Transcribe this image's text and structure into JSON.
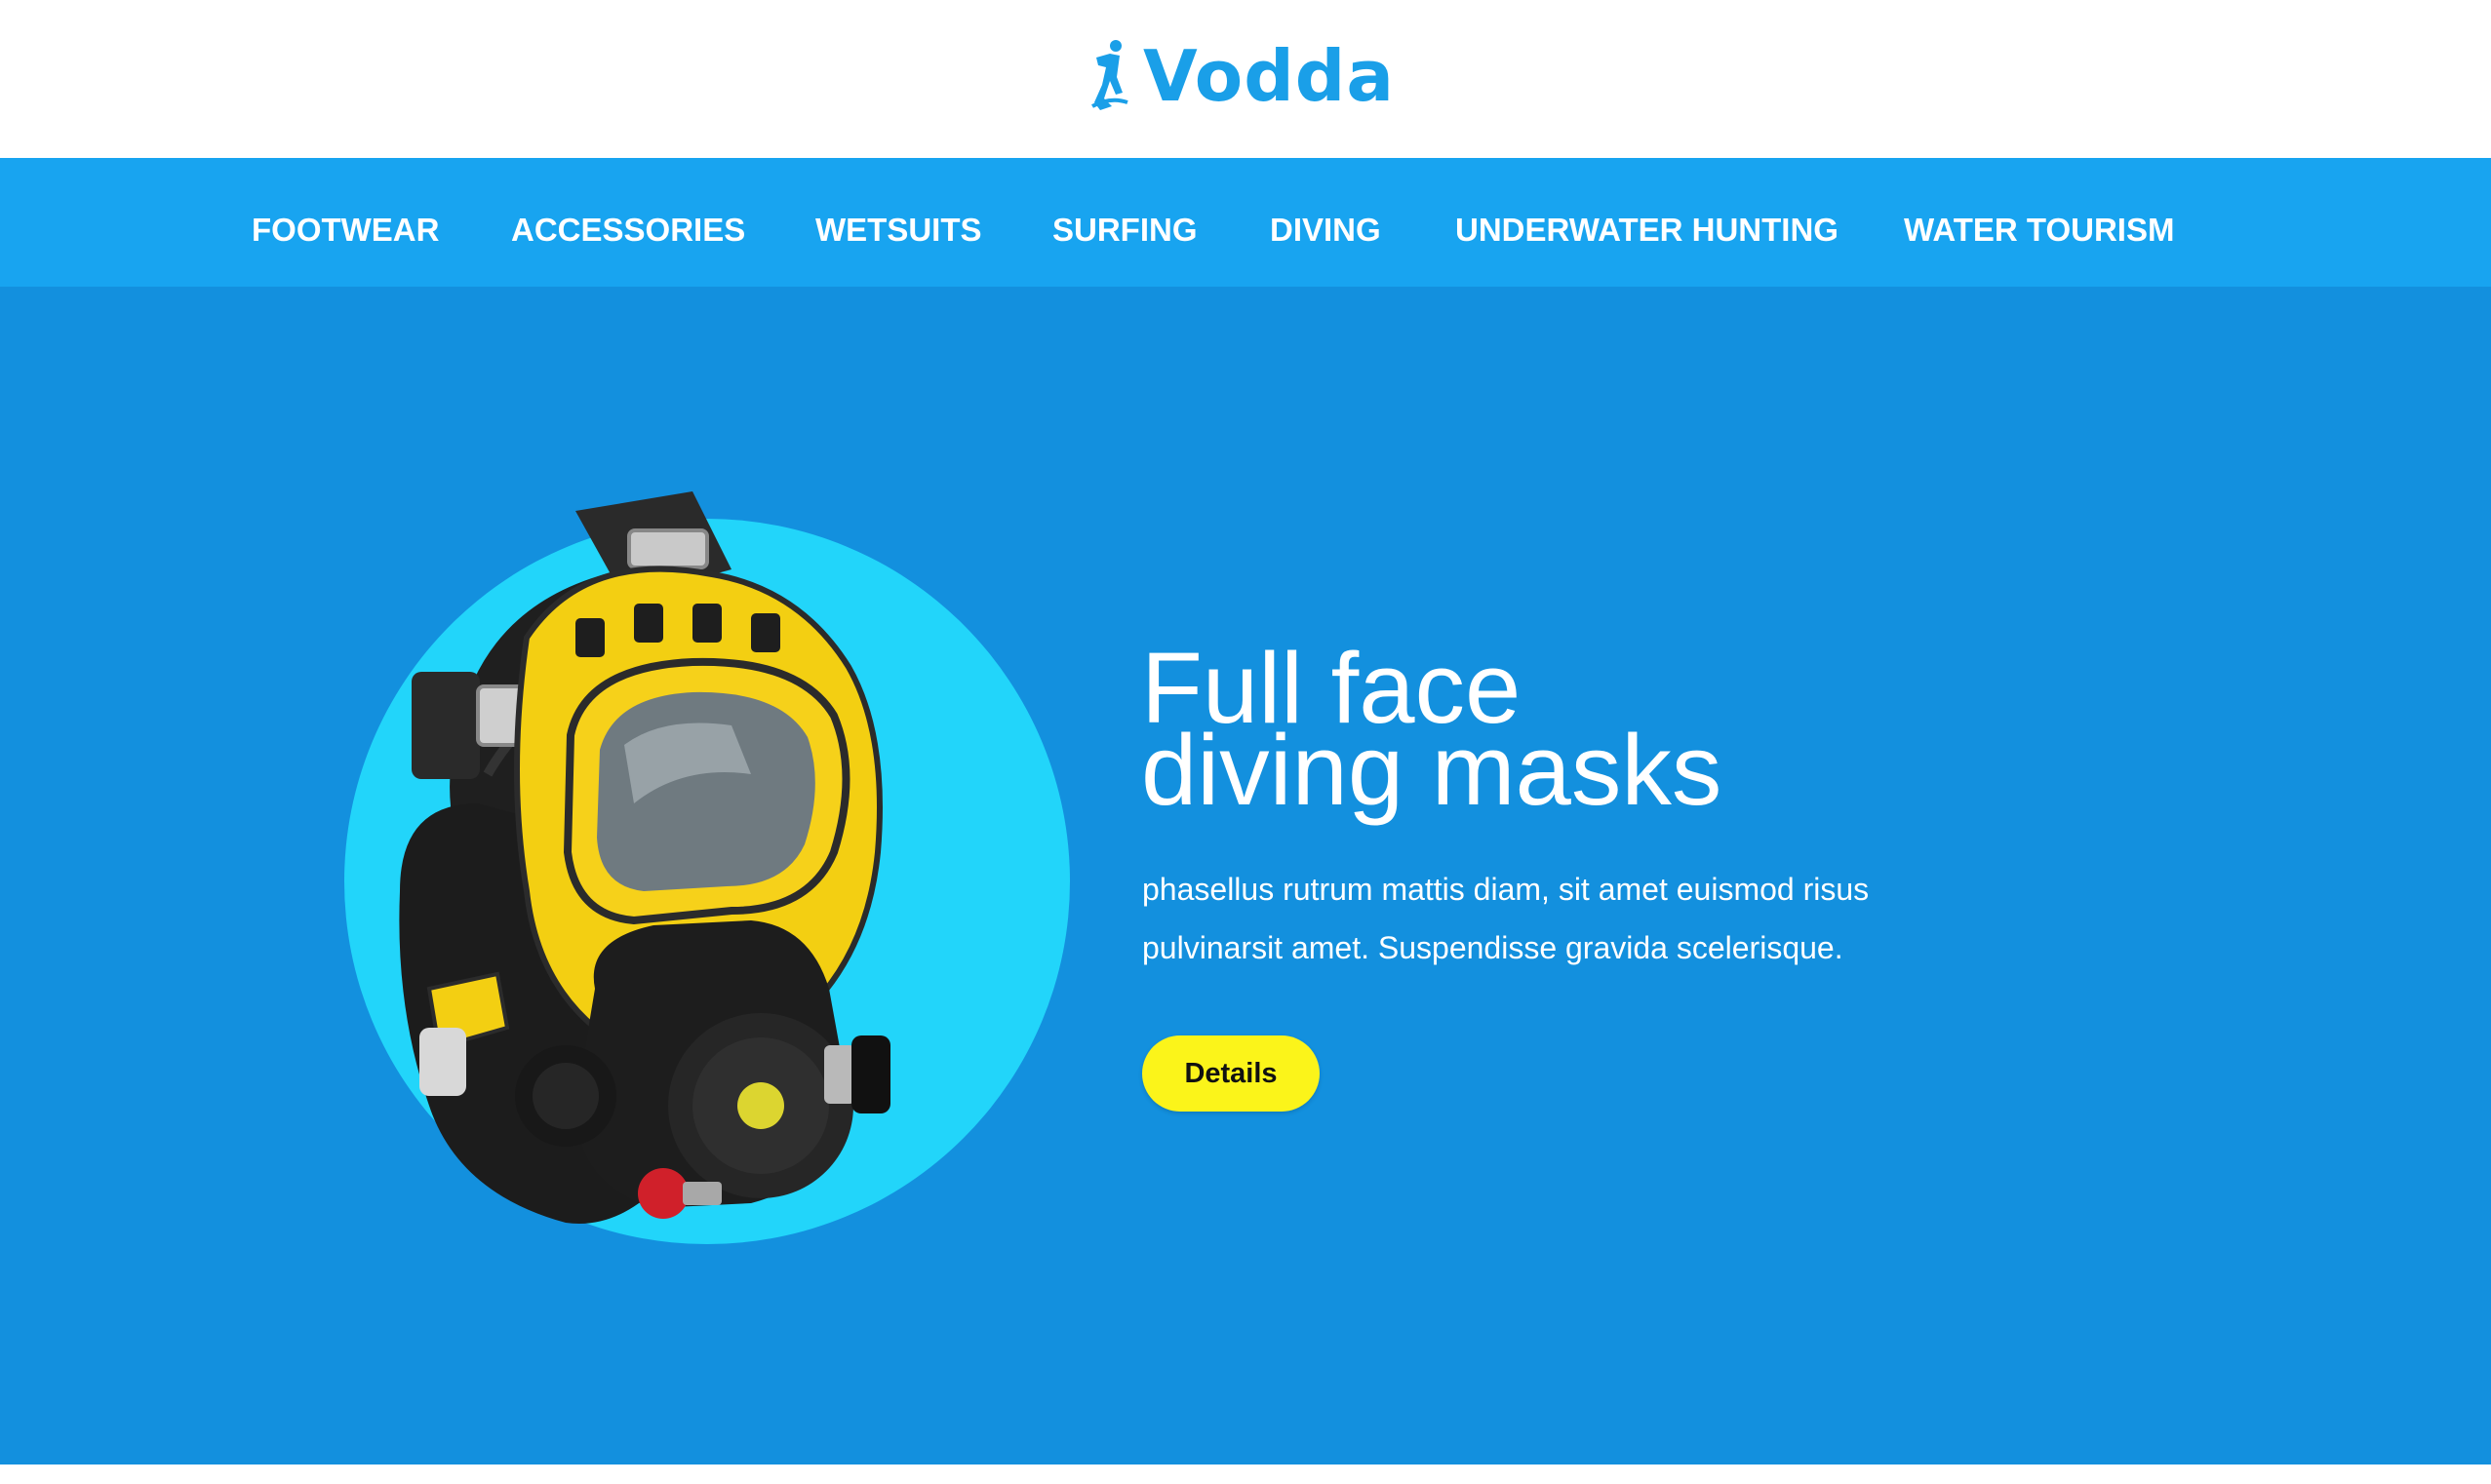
{
  "brand": {
    "name": "Vodda",
    "color": "#1a9fe8"
  },
  "nav": {
    "background": "#18a4f0",
    "items": [
      {
        "label": "FOOTWEAR"
      },
      {
        "label": "ACCESSORIES"
      },
      {
        "label": "WETSUITS"
      },
      {
        "label": "SURFING"
      },
      {
        "label": "DIVING"
      },
      {
        "label": "UNDERWATER HUNTING"
      },
      {
        "label": "WATER TOURISM"
      }
    ]
  },
  "hero": {
    "background": "#1390de",
    "image_icon": "full-face-diving-mask",
    "title_line1": "Full face",
    "title_line2": "diving masks",
    "desc_line1": "phasellus rutrum mattis diam, sit amet euismod risus",
    "desc_line2": "pulvinarsit amet. Suspendisse gravida scelerisque.",
    "button_label": "Details",
    "button_color": "#fbf41a"
  }
}
